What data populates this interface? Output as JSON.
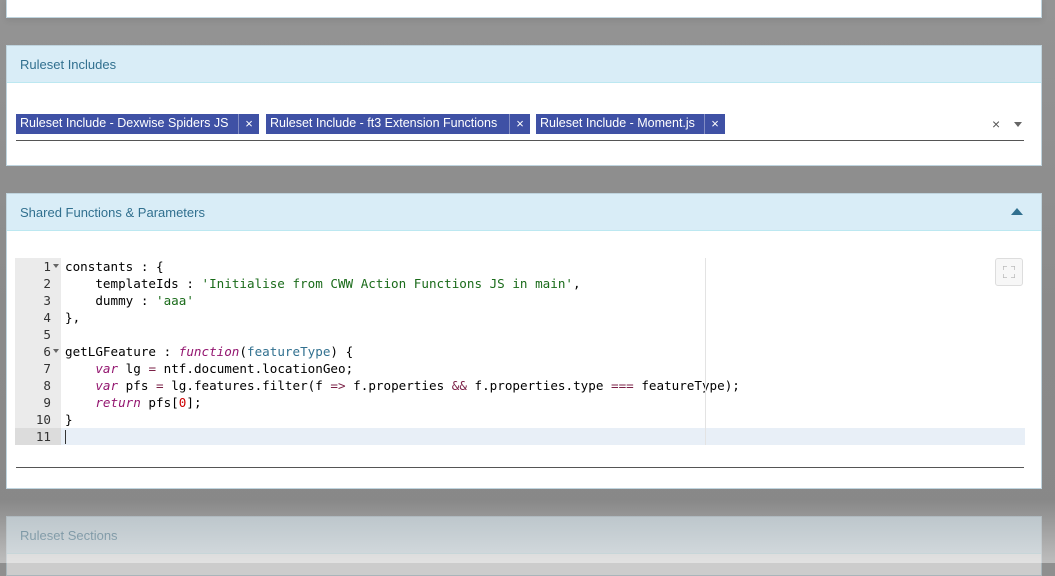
{
  "includes_panel": {
    "title": "Ruleset Includes",
    "tags": [
      {
        "label": "Ruleset Include - Dexwise Spiders JS"
      },
      {
        "label": "Ruleset Include - ft3 Extension Functions"
      },
      {
        "label": "Ruleset Include - Moment.js"
      }
    ],
    "remove_glyph": "×",
    "clear_glyph": "×"
  },
  "shared_panel": {
    "title": "Shared Functions & Parameters",
    "line_numbers": [
      "1",
      "2",
      "3",
      "4",
      "5",
      "6",
      "7",
      "8",
      "9",
      "10",
      "11"
    ]
  },
  "sections_panel": {
    "title": "Ruleset Sections"
  },
  "code_lines": [
    "constants : {",
    "    templateIds : 'Initialise from CWW Action Functions JS in main',",
    "    dummy : 'aaa'",
    "},",
    "",
    "getLGFeature : function(featureType) {",
    "    var lg = ntf.document.locationGeo;",
    "    var pfs = lg.features.filter(f => f.properties && f.properties.type === featureType);",
    "    return pfs[0];",
    "}",
    ""
  ],
  "colors": {
    "panel_heading_bg": "#d9edf7",
    "panel_title": "#31708f",
    "tag_bg": "#3f51a5"
  }
}
